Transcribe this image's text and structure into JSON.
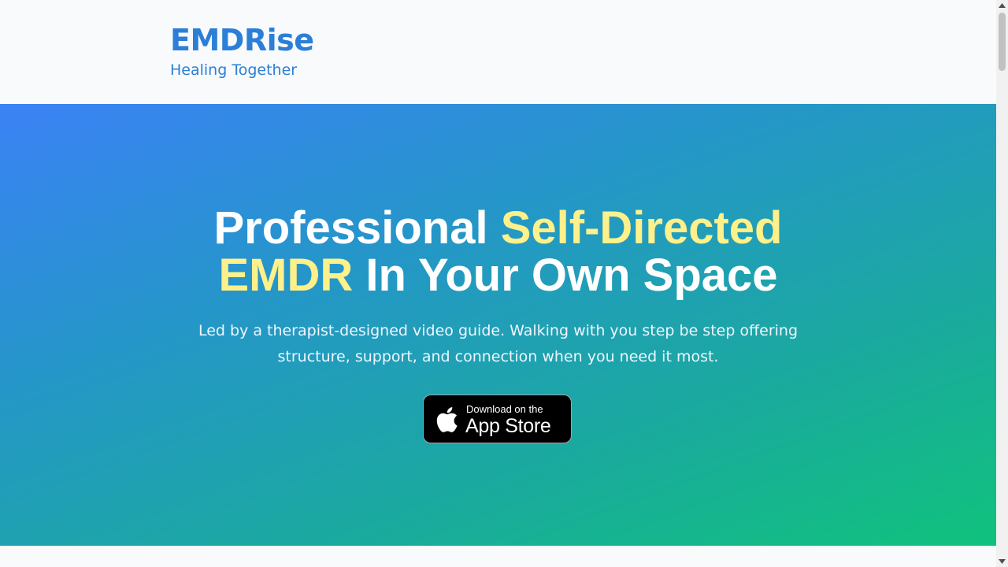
{
  "header": {
    "brand_name": "EMDRise",
    "tagline": "Healing Together"
  },
  "hero": {
    "title_part1": "Professional ",
    "title_highlight1": "Self-Directed",
    "title_highlight2": "EMDR",
    "title_part2": " In Your Own Space",
    "subtitle": "Led by a therapist-designed video guide. Walking with you step be step offering structure, support, and connection when you need it most.",
    "highlight_color": "#fef08a",
    "cta": {
      "icon": "apple-icon",
      "small_text": "Download on the",
      "large_text": "App Store"
    }
  },
  "colors": {
    "brand": "#2b7fd6",
    "gradient_start": "#3b82f6",
    "gradient_end": "#10c27c"
  }
}
